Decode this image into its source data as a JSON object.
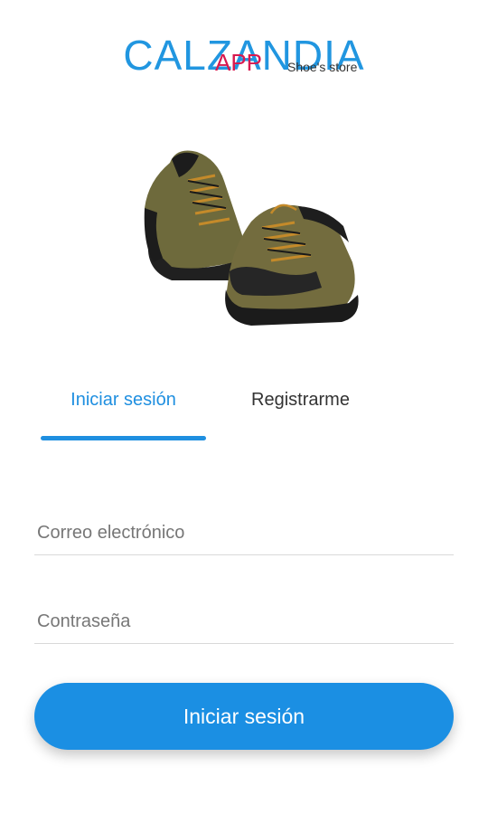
{
  "brand": {
    "name": "CALZANDIA",
    "app": "APP",
    "tagline": "Shoe's store",
    "primary_color": "#2196e0",
    "accent_color": "#d8194f"
  },
  "hero": {
    "image": "hiking-shoes-image"
  },
  "tabs": [
    {
      "label": "Iniciar sesión",
      "active": true
    },
    {
      "label": "Registrarme",
      "active": false
    }
  ],
  "form": {
    "email_placeholder": "Correo electrónico",
    "password_placeholder": "Contraseña",
    "submit_label": "Iniciar sesión"
  }
}
